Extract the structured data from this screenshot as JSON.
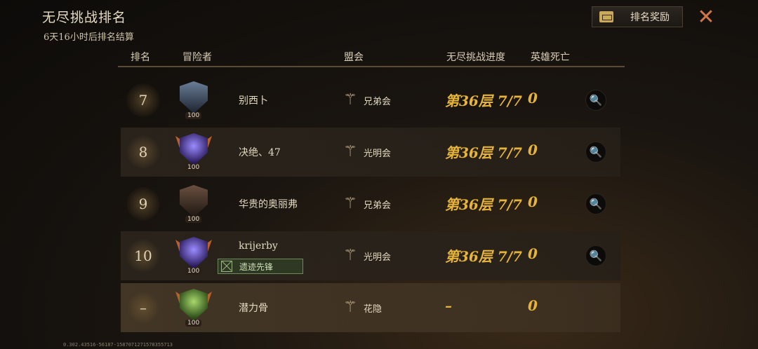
{
  "header": {
    "title": "无尽挑战排名",
    "subtitle": "6天16小时后排名结算",
    "reward_label": "排名奖励",
    "close_glyph": "✕"
  },
  "columns": [
    "排名",
    "冒险者",
    "盟会",
    "无尽挑战进度",
    "英雄死亡"
  ],
  "rows": [
    {
      "rank": "7",
      "name": "别西卜",
      "guild": "兄弟会",
      "progress": "第36层 7/7",
      "deaths": "0",
      "level": "100",
      "avatar": "hooded-wraith"
    },
    {
      "rank": "8",
      "name": "决绝、47",
      "guild": "光明会",
      "progress": "第36层 7/7",
      "deaths": "0",
      "level": "100",
      "avatar": "purple-mage-crest"
    },
    {
      "rank": "9",
      "name": "华贵的奥丽弗",
      "guild": "兄弟会",
      "progress": "第36层 7/7",
      "deaths": "0",
      "level": "100",
      "avatar": "bearded-warrior"
    },
    {
      "rank": "10",
      "name": "krijerby",
      "guild": "光明会",
      "progress": "第36层 7/7",
      "deaths": "0",
      "level": "100",
      "avatar": "purple-mage-crest",
      "badge": "遗迹先锋"
    },
    {
      "rank": "–",
      "name": "潜力骨",
      "guild": "花隐",
      "progress": "–",
      "deaths": "0",
      "level": "100",
      "avatar": "green-druid-crest"
    }
  ],
  "search_glyph": "🔍",
  "guild_glyph": "⚚",
  "footer_code": "0.302.43516-56187-1587071271578355713",
  "colors": {
    "accent_gold": "#e7b43a",
    "close_orange": "#d0774a",
    "badge_green": "#6d8a5a"
  }
}
